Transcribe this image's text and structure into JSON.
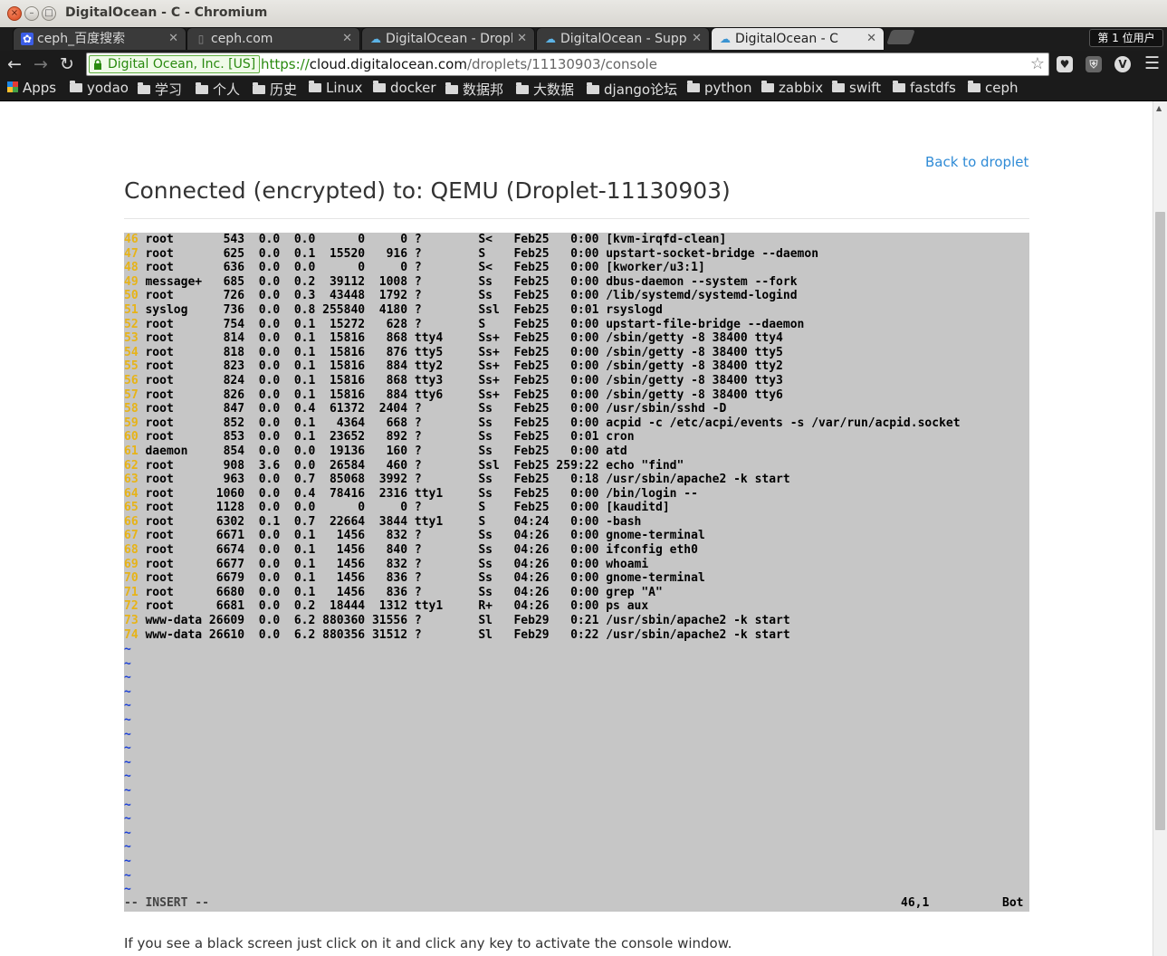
{
  "window": {
    "title": "DigitalOcean - C - Chromium",
    "min": "–",
    "max": "□",
    "close": "×"
  },
  "tabs": [
    {
      "label": "ceph_百度搜索",
      "icon": "baidu-paw-icon",
      "active": false
    },
    {
      "label": "ceph.com",
      "icon": "page-icon",
      "active": false
    },
    {
      "label": "DigitalOcean - Dropl",
      "icon": "digitalocean-cloud-icon",
      "active": false
    },
    {
      "label": "DigitalOcean - Suppo",
      "icon": "digitalocean-cloud-icon",
      "active": false
    },
    {
      "label": "DigitalOcean - C",
      "icon": "digitalocean-cloud-icon",
      "active": true
    }
  ],
  "user_badge": "第 1 位用户",
  "toolbar": {
    "ev_name": "Digital Ocean, Inc. [US]",
    "url_scheme": "https://",
    "url_host": "cloud.digitalocean.com",
    "url_path": "/droplets/11130903/console"
  },
  "bookmarks": [
    "Apps",
    "yodao",
    "学习",
    "个人",
    "历史",
    "Linux",
    "docker",
    "数据邦",
    "大数据",
    "django论坛",
    "python",
    "zabbix",
    "swift",
    "fastdfs",
    "ceph"
  ],
  "page": {
    "back_link": "Back to droplet",
    "heading": "Connected (encrypted) to: QEMU (Droplet-11130903)",
    "hint": "If you see a black screen just click on it and click any key to activate the console window."
  },
  "console": {
    "colors": {
      "background": "#c6c6c6",
      "line_number": "#e7b317",
      "tilde": "#1a3fd6"
    },
    "lines": [
      {
        "n": "46",
        "text": "root       543  0.0  0.0      0     0 ?        S<   Feb25   0:00 [kvm-irqfd-clean]"
      },
      {
        "n": "47",
        "text": "root       625  0.0  0.1  15520   916 ?        S    Feb25   0:00 upstart-socket-bridge --daemon"
      },
      {
        "n": "48",
        "text": "root       636  0.0  0.0      0     0 ?        S<   Feb25   0:00 [kworker/u3:1]"
      },
      {
        "n": "49",
        "text": "message+   685  0.0  0.2  39112  1008 ?        Ss   Feb25   0:00 dbus-daemon --system --fork"
      },
      {
        "n": "50",
        "text": "root       726  0.0  0.3  43448  1792 ?        Ss   Feb25   0:00 /lib/systemd/systemd-logind"
      },
      {
        "n": "51",
        "text": "syslog     736  0.0  0.8 255840  4180 ?        Ssl  Feb25   0:01 rsyslogd"
      },
      {
        "n": "52",
        "text": "root       754  0.0  0.1  15272   628 ?        S    Feb25   0:00 upstart-file-bridge --daemon"
      },
      {
        "n": "53",
        "text": "root       814  0.0  0.1  15816   868 tty4     Ss+  Feb25   0:00 /sbin/getty -8 38400 tty4"
      },
      {
        "n": "54",
        "text": "root       818  0.0  0.1  15816   876 tty5     Ss+  Feb25   0:00 /sbin/getty -8 38400 tty5"
      },
      {
        "n": "55",
        "text": "root       823  0.0  0.1  15816   884 tty2     Ss+  Feb25   0:00 /sbin/getty -8 38400 tty2"
      },
      {
        "n": "56",
        "text": "root       824  0.0  0.1  15816   868 tty3     Ss+  Feb25   0:00 /sbin/getty -8 38400 tty3"
      },
      {
        "n": "57",
        "text": "root       826  0.0  0.1  15816   884 tty6     Ss+  Feb25   0:00 /sbin/getty -8 38400 tty6"
      },
      {
        "n": "58",
        "text": "root       847  0.0  0.4  61372  2404 ?        Ss   Feb25   0:00 /usr/sbin/sshd -D"
      },
      {
        "n": "59",
        "text": "root       852  0.0  0.1   4364   668 ?        Ss   Feb25   0:00 acpid -c /etc/acpi/events -s /var/run/acpid.socket"
      },
      {
        "n": "60",
        "text": "root       853  0.0  0.1  23652   892 ?        Ss   Feb25   0:01 cron"
      },
      {
        "n": "61",
        "text": "daemon     854  0.0  0.0  19136   160 ?        Ss   Feb25   0:00 atd"
      },
      {
        "n": "62",
        "text": "root       908  3.6  0.0  26584   460 ?        Ssl  Feb25 259:22 echo \"find\""
      },
      {
        "n": "63",
        "text": "root       963  0.0  0.7  85068  3992 ?        Ss   Feb25   0:18 /usr/sbin/apache2 -k start"
      },
      {
        "n": "64",
        "text": "root      1060  0.0  0.4  78416  2316 tty1     Ss   Feb25   0:00 /bin/login --"
      },
      {
        "n": "65",
        "text": "root      1128  0.0  0.0      0     0 ?        S    Feb25   0:00 [kauditd]"
      },
      {
        "n": "66",
        "text": "root      6302  0.1  0.7  22664  3844 tty1     S    04:24   0:00 -bash"
      },
      {
        "n": "67",
        "text": "root      6671  0.0  0.1   1456   832 ?        Ss   04:26   0:00 gnome-terminal"
      },
      {
        "n": "68",
        "text": "root      6674  0.0  0.1   1456   840 ?        Ss   04:26   0:00 ifconfig eth0"
      },
      {
        "n": "69",
        "text": "root      6677  0.0  0.1   1456   832 ?        Ss   04:26   0:00 whoami"
      },
      {
        "n": "70",
        "text": "root      6679  0.0  0.1   1456   836 ?        Ss   04:26   0:00 gnome-terminal"
      },
      {
        "n": "71",
        "text": "root      6680  0.0  0.1   1456   836 ?        Ss   04:26   0:00 grep \"A\""
      },
      {
        "n": "72",
        "text": "root      6681  0.0  0.2  18444  1312 tty1     R+   04:26   0:00 ps aux"
      },
      {
        "n": "73",
        "text": "www-data 26609  0.0  6.2 880360 31556 ?        Sl   Feb29   0:21 /usr/sbin/apache2 -k start"
      },
      {
        "n": "74",
        "text": "www-data 26610  0.0  6.2 880356 31512 ?        Sl   Feb29   0:22 /usr/sbin/apache2 -k start"
      }
    ],
    "tilde": "~",
    "status_mode": "-- INSERT --",
    "status_position": "46,1",
    "status_scroll": "Bot"
  }
}
